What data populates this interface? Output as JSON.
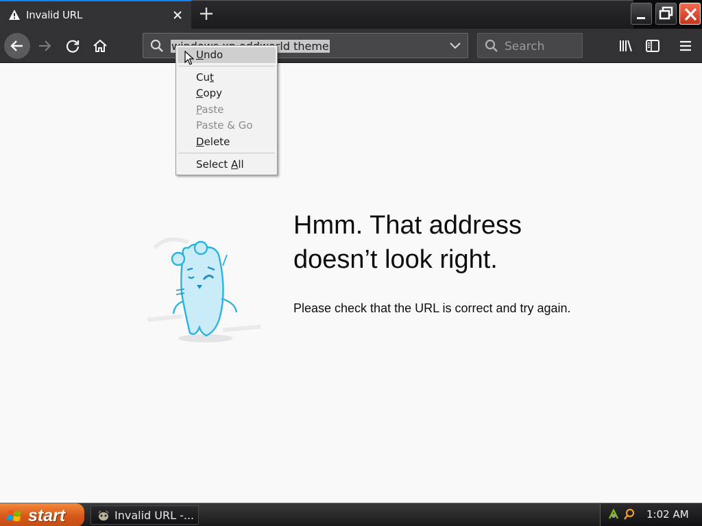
{
  "browser": {
    "tab": {
      "title": "Invalid URL",
      "icon": "warning-icon"
    },
    "new_tab_icon": "plus-icon",
    "window_controls": [
      "minimize-icon",
      "restore-icon",
      "close-icon"
    ],
    "nav": {
      "back_icon": "back-arrow-icon",
      "forward_icon": "forward-arrow-icon",
      "reload_icon": "reload-icon",
      "home_icon": "home-icon"
    },
    "url_bar": {
      "value": "windows xp oddworld theme"
    },
    "search_bar": {
      "placeholder": "Search"
    },
    "toolbar_icons": [
      "library-icon",
      "sidebar-icon",
      "hamburger-menu-icon"
    ]
  },
  "context_menu": {
    "items": [
      {
        "label": "Undo",
        "access_key": "U",
        "enabled": true,
        "hovered": true
      },
      {
        "label": "Cut",
        "access_key": "t",
        "enabled": true
      },
      {
        "label": "Copy",
        "access_key": "C",
        "enabled": true
      },
      {
        "label": "Paste",
        "access_key": "P",
        "enabled": false
      },
      {
        "label": "Paste & Go",
        "enabled": false
      },
      {
        "label": "Delete",
        "access_key": "D",
        "enabled": true
      },
      {
        "label": "Select All",
        "access_key": "A",
        "enabled": true
      }
    ]
  },
  "error_page": {
    "title": "Hmm. That address doesn’t look right.",
    "description": "Please check that the URL is correct and try again."
  },
  "taskbar": {
    "start_label": "start",
    "task_label": "Invalid URL -...",
    "clock": "1:02 AM"
  },
  "colors": {
    "accent": "#0a84ff",
    "tab_active": "#323234",
    "page_bg": "#f9f9fa",
    "close_red": "#e0452b",
    "start_orange": "#e06a26"
  }
}
